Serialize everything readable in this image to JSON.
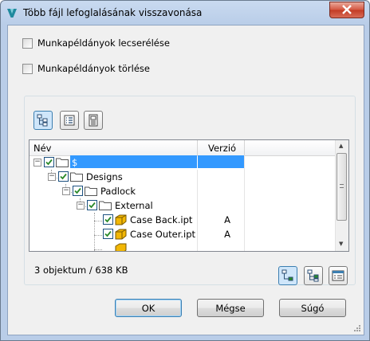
{
  "window": {
    "title": "Több fájl lefoglalásának visszavonása"
  },
  "options": {
    "replace_label": "Munkapéldányok lecserélése",
    "delete_label": "Munkapéldányok törlése"
  },
  "grid": {
    "columns": [
      "Név",
      "Verzió"
    ],
    "rows": [
      {
        "label": "$",
        "version": "",
        "level": 0,
        "type": "folder",
        "selected": true
      },
      {
        "label": "Designs",
        "version": "",
        "level": 1,
        "type": "folder"
      },
      {
        "label": "Padlock",
        "version": "",
        "level": 2,
        "type": "folder"
      },
      {
        "label": "External",
        "version": "",
        "level": 3,
        "type": "folder"
      },
      {
        "label": "Case Back.ipt",
        "version": "A",
        "level": 4,
        "type": "part"
      },
      {
        "label": "Case Outer.ipt",
        "version": "A",
        "level": 4,
        "type": "part"
      }
    ]
  },
  "status": {
    "text": "3 objektum / 638 KB"
  },
  "buttons": {
    "ok": "OK",
    "cancel": "Mégse",
    "help": "Súgó"
  },
  "colors": {
    "selection": "#3399ff",
    "checkbox_check": "#2a8a2a",
    "part_icon": "#f2b705"
  },
  "icons": {
    "toolbar": [
      "tree-view-icon",
      "list-view-icon",
      "details-view-icon"
    ],
    "bottom": [
      "expand-tree-icon",
      "collapse-tree-icon",
      "properties-icon"
    ]
  }
}
